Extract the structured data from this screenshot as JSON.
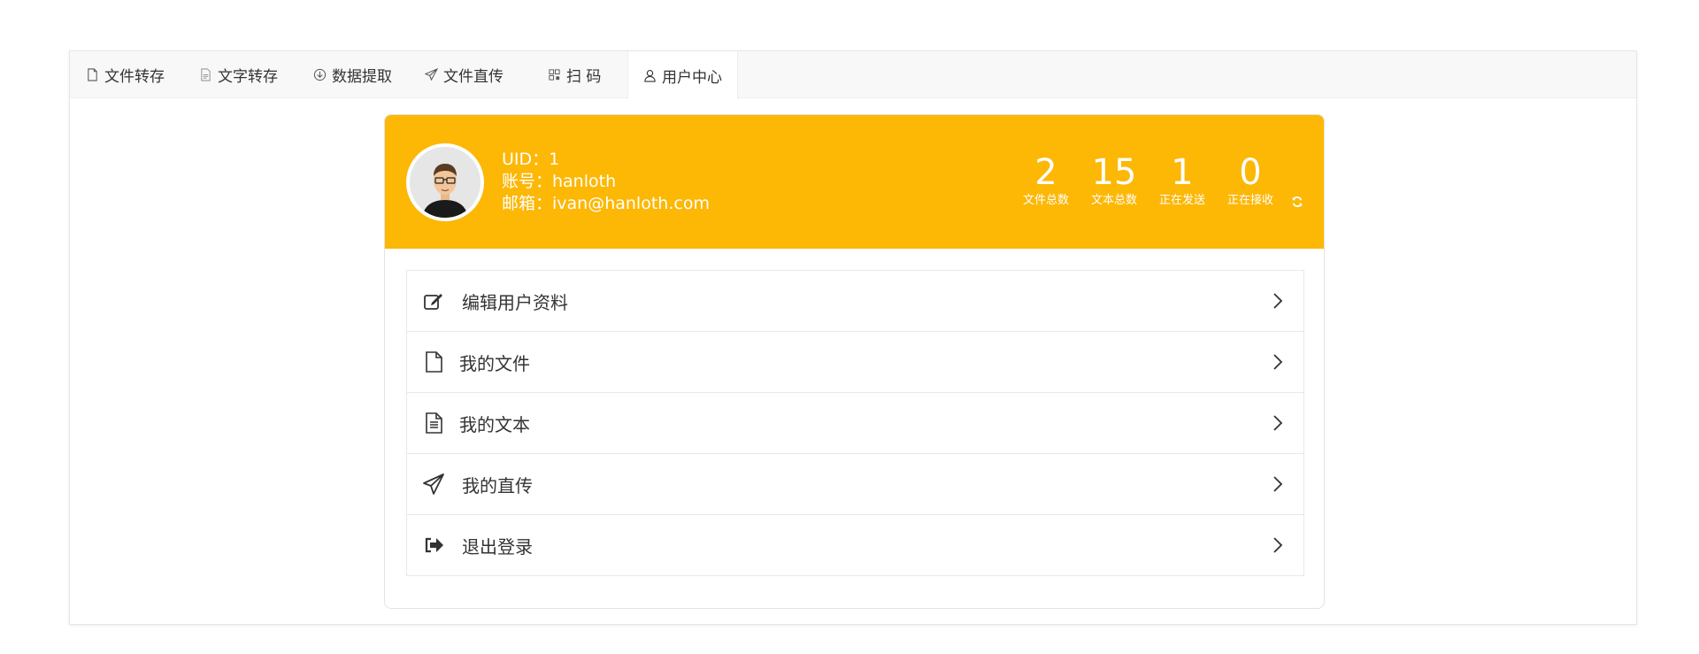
{
  "tabs": [
    {
      "label": "文件转存",
      "icon": "file-icon"
    },
    {
      "label": "文字转存",
      "icon": "text-file-icon"
    },
    {
      "label": "数据提取",
      "icon": "download-circle-icon"
    },
    {
      "label": "文件直传",
      "icon": "paper-plane-icon"
    },
    {
      "label": "扫 码",
      "icon": "qrcode-icon"
    },
    {
      "label": "用户中心",
      "icon": "user-icon",
      "active": true
    }
  ],
  "profile": {
    "uid": "UID：1",
    "account": "账号：hanloth",
    "email": "邮箱：ivan@hanloth.com"
  },
  "stats": [
    {
      "value": "2",
      "label": "文件总数"
    },
    {
      "value": "15",
      "label": "文本总数"
    },
    {
      "value": "1",
      "label": "正在发送"
    },
    {
      "value": "0",
      "label": "正在接收"
    }
  ],
  "menu": [
    {
      "label": "编辑用户资料",
      "icon": "edit-icon"
    },
    {
      "label": "我的文件",
      "icon": "file-icon"
    },
    {
      "label": "我的文本",
      "icon": "document-text-icon"
    },
    {
      "label": "我的直传",
      "icon": "paper-plane-icon"
    },
    {
      "label": "退出登录",
      "icon": "sign-out-icon"
    }
  ],
  "colors": {
    "header_bg": "#fdb705",
    "tabbar_bg": "#f8f8f8"
  }
}
